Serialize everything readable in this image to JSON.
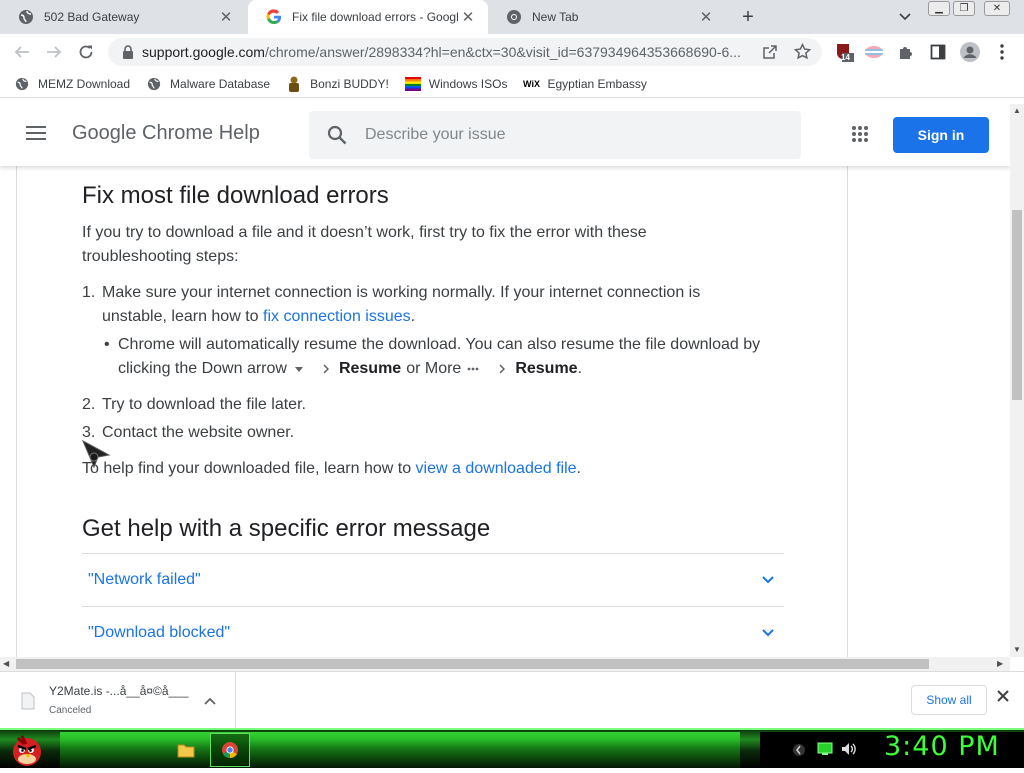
{
  "browser": {
    "tabs": [
      {
        "title": "502 Bad Gateway",
        "icon": "globe-icon",
        "active": false
      },
      {
        "title": "Fix file download errors - Google",
        "icon": "google-icon",
        "active": true
      },
      {
        "title": "New Tab",
        "icon": "chrome-icon",
        "active": false
      }
    ],
    "url_host": "support.google.com",
    "url_rest": "/chrome/answer/2898334?hl=en&ctx=30&visit_id=637934964353668690-6...",
    "extension_badge": "14",
    "bookmarks": [
      {
        "label": "MEMZ Download",
        "icon": "globe-icon"
      },
      {
        "label": "Malware Database",
        "icon": "globe-icon"
      },
      {
        "label": "Bonzi BUDDY!",
        "icon": "bonzi-icon"
      },
      {
        "label": "Windows ISOs",
        "icon": "windows-flag-icon"
      },
      {
        "label": "Egyptian Embassy",
        "icon": "wix-icon"
      }
    ]
  },
  "help": {
    "title": "Google Chrome Help",
    "search_placeholder": "Describe your issue",
    "signin_label": "Sign in"
  },
  "article": {
    "heading": "Fix most file download errors",
    "intro": "If you try to download a file and it doesn’t work, first try to fix the error with these troubleshooting steps:",
    "step1_num": "1.",
    "step1_line1": "Make sure your internet connection is working normally. If your internet connection is",
    "step1_line2_pre": "unstable, learn how to ",
    "step1_link": "fix connection issues",
    "step1_line2_post": ".",
    "bullet_line1": "Chrome will automatically resume the download. You can also resume the file download by",
    "bullet_line2_pre": "clicking the Down arrow",
    "bullet_resume1": "Resume",
    "bullet_or_more": "or More",
    "bullet_resume2": "Resume",
    "bullet_end": ".",
    "step2_num": "2.",
    "step2": "Try to download the file later.",
    "step3_num": "3.",
    "step3": "Contact the website owner.",
    "find_pre": "To help find your downloaded file, learn how to ",
    "find_link": "view a downloaded file",
    "find_post": ".",
    "heading2": "Get help with a specific error message",
    "accordions": [
      "\"Network failed\"",
      "\"Download blocked\""
    ]
  },
  "downloads": {
    "file_name": "Y2Mate.is -...å__å¤©å___",
    "status": "Canceled",
    "show_all": "Show all"
  },
  "taskbar": {
    "clock": "3:40 PM"
  },
  "colors": {
    "link": "#1a73e8",
    "signin_bg": "#1a73e8",
    "taskbar_green": "#3cff3c"
  }
}
